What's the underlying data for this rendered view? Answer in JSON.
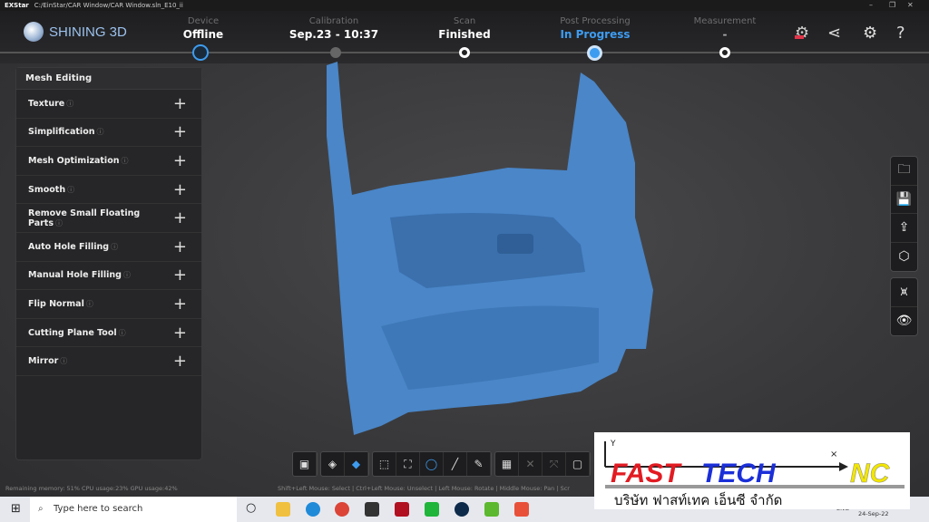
{
  "titlebar": {
    "app": "EXStar",
    "path": "C:/EinStar/CAR Window/CAR Window.sln_E10_ii",
    "min": "–",
    "max": "❐",
    "close": "✕"
  },
  "header": {
    "brand": "SHINING 3D",
    "steps": [
      {
        "label": "Device",
        "value": "Offline"
      },
      {
        "label": "Calibration",
        "value": "Sep.23 - 10:37"
      },
      {
        "label": "Scan",
        "value": "Finished"
      },
      {
        "label": "Post Processing",
        "value": "In Progress"
      },
      {
        "label": "Measurement",
        "value": "-"
      }
    ],
    "icons": [
      "new-feature-icon",
      "share-icon",
      "settings-icon",
      "help-icon"
    ],
    "accent": "#3d9cf0"
  },
  "panel": {
    "title": "Mesh Editing",
    "items": [
      {
        "label": "Texture"
      },
      {
        "label": "Simplification"
      },
      {
        "label": "Mesh Optimization"
      },
      {
        "label": "Smooth"
      },
      {
        "label": "Remove Small Floating Parts"
      },
      {
        "label": "Auto Hole Filling"
      },
      {
        "label": "Manual Hole Filling"
      },
      {
        "label": "Flip Normal"
      },
      {
        "label": "Cutting Plane Tool"
      },
      {
        "label": "Mirror"
      }
    ]
  },
  "right_toolbar": [
    "open-folder-icon",
    "save-icon",
    "export-icon",
    "model-view-icon",
    "mesh-mode-icon",
    "visibility-icon"
  ],
  "status": {
    "resources": "Remaining memory: 51% CPU usage:23% GPU usage:42%",
    "hints": "Shift+Left Mouse: Select | Ctrl+Left Mouse: Unselect | Left Mouse: Rotate | Middle Mouse: Pan | Scr"
  },
  "taskbar": {
    "search_placeholder": "Type here to search",
    "date": "24-Sep-22",
    "lang": "ENG"
  },
  "overlay": {
    "brand": "FASTTECH NC",
    "thai": "บริษัท ฟาสท์เทค เอ็นซี จำกัด",
    "y": "Y",
    "x": "×"
  },
  "mesh_color": "#4a86c8"
}
